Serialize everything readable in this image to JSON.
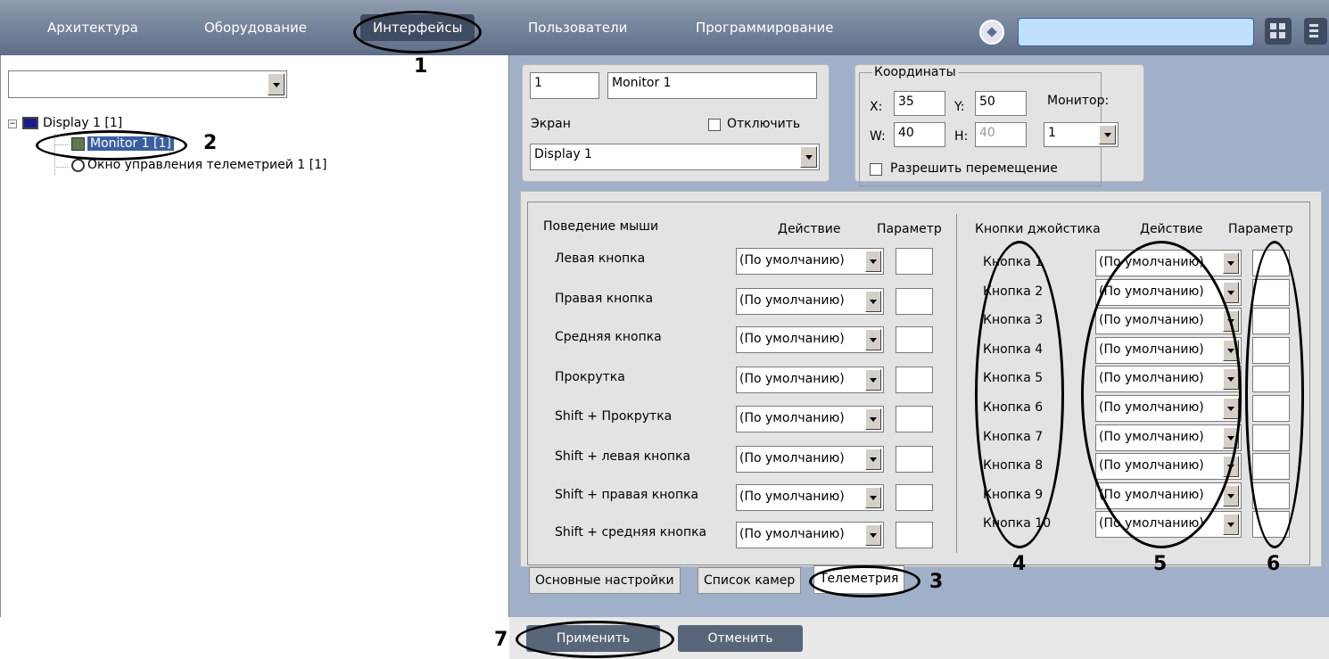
{
  "nav": {
    "tabs": [
      "Архитектура",
      "Оборудование",
      "Интерфейсы",
      "Пользователи",
      "Программирование"
    ],
    "active": "Интерфейсы",
    "search_value": ""
  },
  "left": {
    "combo_value": "",
    "tree": {
      "root": "Display 1 [1]",
      "child1": "Monitor 1 [1]",
      "child2": "Окно управления телеметрией 1 [1]"
    }
  },
  "props": {
    "id_value": "1",
    "name_value": "Monitor 1",
    "screen_label": "Экран",
    "disable_label": "Отключить",
    "screen_value": "Display 1"
  },
  "coords": {
    "title": "Координаты",
    "x_label": "X:",
    "x_value": "35",
    "y_label": "Y:",
    "y_value": "50",
    "w_label": "W:",
    "w_value": "40",
    "h_label": "H:",
    "h_value": "40",
    "monitor_label": "Монитор:",
    "monitor_value": "1",
    "allow_move_label": "Разрешить перемещение"
  },
  "mouse": {
    "header": "Поведение мыши",
    "action_header": "Действие",
    "param_header": "Параметр",
    "rows": [
      "Левая кнопка",
      "Правая кнопка",
      "Средняя кнопка",
      "Прокрутка",
      "Shift + Прокрутка",
      "Shift + левая кнопка",
      "Shift + правая кнопка",
      "Shift + средняя кнопка"
    ],
    "default_action": "(По умолчанию)"
  },
  "joystick": {
    "header": "Кнопки джойстика",
    "action_header": "Действие",
    "param_header": "Параметр",
    "rows": [
      "Кнопка 1",
      "Кнопка 2",
      "Кнопка 3",
      "Кнопка 4",
      "Кнопка 5",
      "Кнопка 6",
      "Кнопка 7",
      "Кнопка 8",
      "Кнопка 9",
      "Кнопка 10"
    ],
    "default_action": "(По умолчанию)"
  },
  "tabs": [
    "Основные настройки",
    "Список камер",
    "Телеметрия"
  ],
  "buttons": {
    "apply": "Применить",
    "cancel": "Отменить"
  },
  "annotations": [
    "1",
    "2",
    "3",
    "4",
    "5",
    "6",
    "7"
  ]
}
